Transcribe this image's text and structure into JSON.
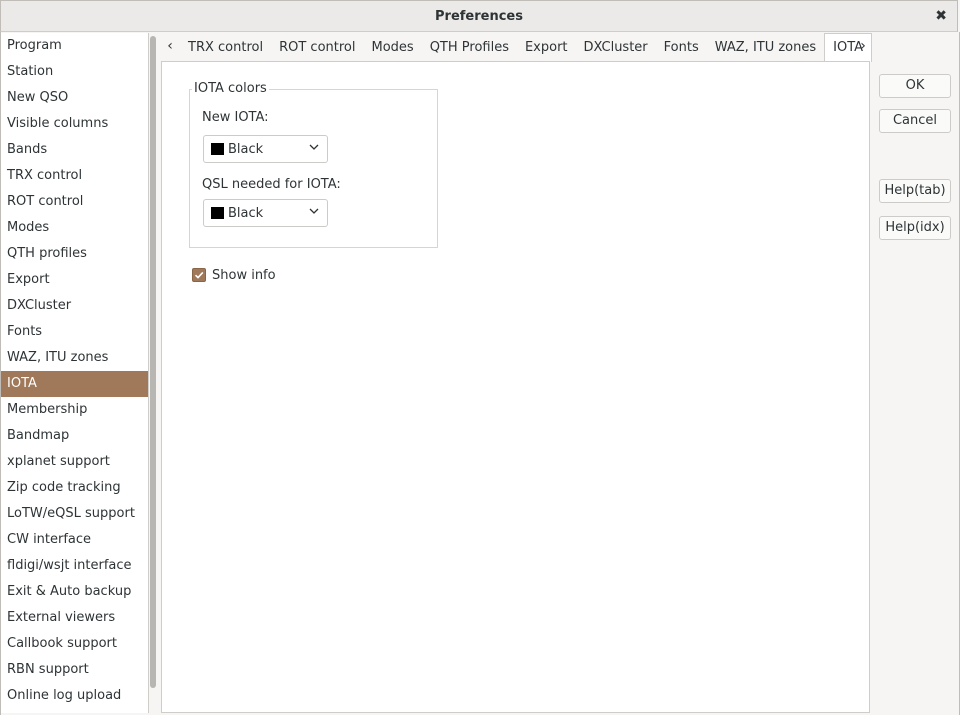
{
  "window": {
    "title": "Preferences"
  },
  "sidebar": {
    "items": [
      "Program",
      "Station",
      "New QSO",
      "Visible columns",
      "Bands",
      "TRX control",
      "ROT control",
      "Modes",
      "QTH profiles",
      "Export",
      "DXCluster",
      "Fonts",
      "WAZ, ITU zones",
      "IOTA",
      "Membership",
      "Bandmap",
      "xplanet support",
      "Zip code tracking",
      "LoTW/eQSL support",
      "CW interface",
      "fldigi/wsjt interface",
      "Exit & Auto backup",
      "External viewers",
      "Callbook support",
      "RBN support",
      "Online log upload"
    ],
    "active_index": 13
  },
  "tabs": {
    "items": [
      "TRX control",
      "ROT control",
      "Modes",
      "QTH Profiles",
      "Export",
      "DXCluster",
      "Fonts",
      "WAZ, ITU zones",
      "IOTA"
    ],
    "active_index": 8
  },
  "iota": {
    "group_title": "IOTA colors",
    "new_iota_label": "New IOTA:",
    "new_iota_value": "Black",
    "qsl_needed_label": "QSL needed for IOTA:",
    "qsl_needed_value": "Black",
    "show_info_label": "Show info",
    "show_info_checked": true
  },
  "buttons": {
    "ok": "OK",
    "cancel": "Cancel",
    "help_tab": "Help(tab)",
    "help_idx": "Help(idx)"
  },
  "colors": {
    "accent": "#a0785a",
    "swatch": "#000000"
  }
}
